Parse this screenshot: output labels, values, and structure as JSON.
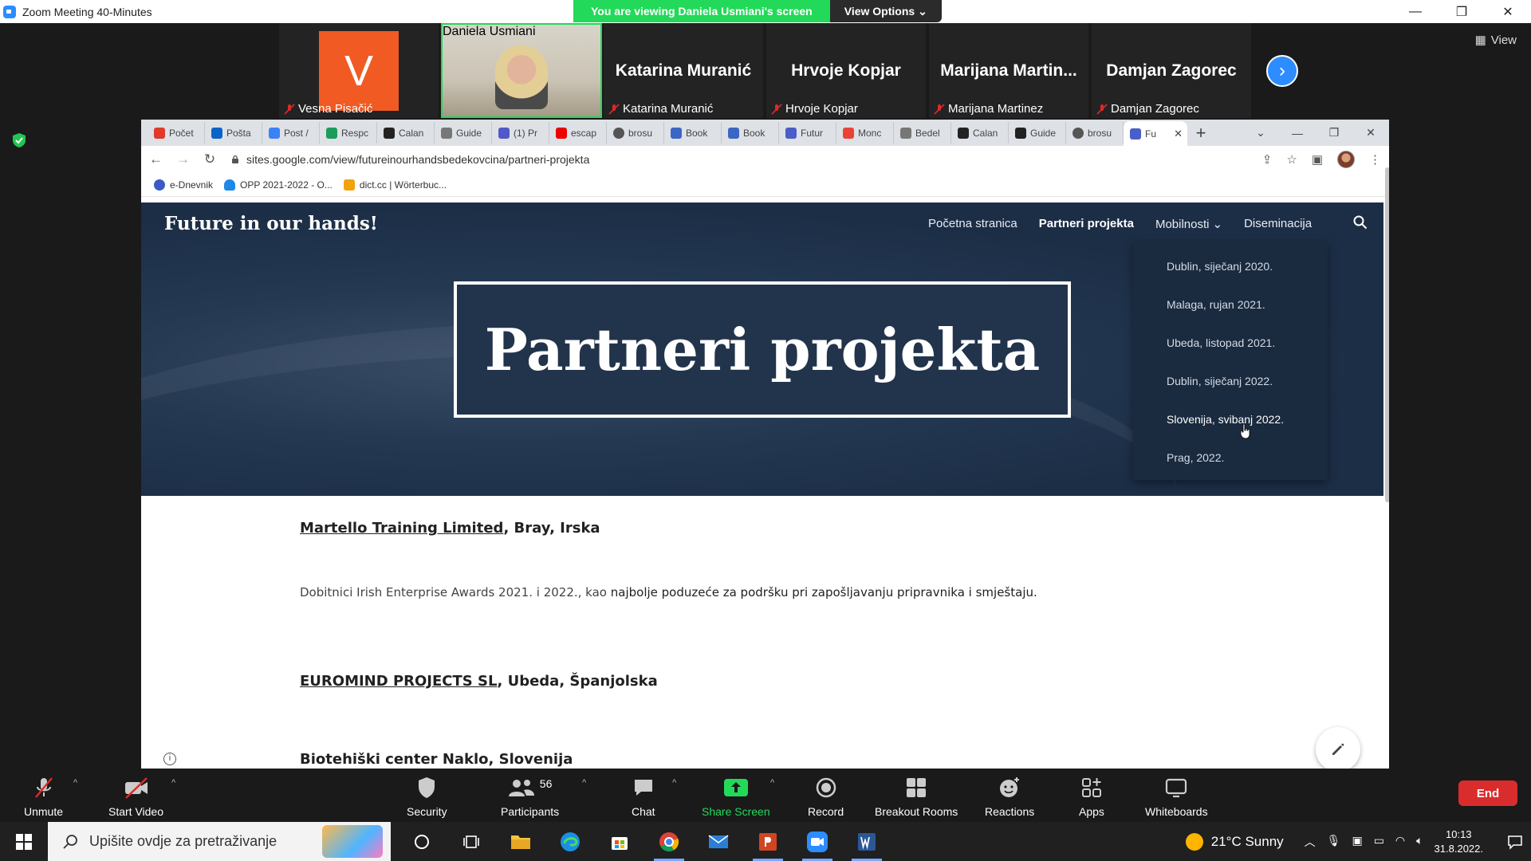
{
  "zoom": {
    "window_title": "Zoom Meeting 40-Minutes",
    "share_banner": "You are viewing Daniela Usmiani's screen",
    "view_options": "View Options",
    "view_label": "View",
    "participants_strip": [
      {
        "name": "Vesna Pisačić",
        "avatar_letter": "V"
      },
      {
        "name": "Daniela Usmiani"
      },
      {
        "name": "Katarina Muranić",
        "display": "Katarina Muranić"
      },
      {
        "name": "Hrvoje Kopjar",
        "display": "Hrvoje Kopjar"
      },
      {
        "name": "Marijana Martinez",
        "display": "Marijana  Martin..."
      },
      {
        "name": "Damjan Zagorec",
        "display": "Damjan Zagorec"
      }
    ],
    "toolbar": {
      "unmute": "Unmute",
      "start_video": "Start Video",
      "security": "Security",
      "participants": "Participants",
      "participants_count": "56",
      "chat": "Chat",
      "share_screen": "Share Screen",
      "record": "Record",
      "breakout_rooms": "Breakout Rooms",
      "reactions": "Reactions",
      "apps": "Apps",
      "whiteboards": "Whiteboards",
      "end": "End"
    }
  },
  "browser": {
    "tabs": [
      "Počet",
      "Pošta",
      "Post /",
      "Respc",
      "Calan",
      "Guide",
      "(1) Pr",
      "escap",
      "brosu",
      "Book",
      "Book",
      "Futur",
      "Monc",
      "Bedel",
      "Calan",
      "Guide",
      "brosu",
      "Fu"
    ],
    "url": "sites.google.com/view/futureinourhandsbedekovcina/partneri-projekta",
    "bookmarks": [
      "e-Dnevnik",
      "OPP 2021-2022 - O...",
      "dict.cc | Wörterbuc..."
    ]
  },
  "site": {
    "title": "Future in our hands!",
    "nav": {
      "home": "Početna stranica",
      "partners": "Partneri projekta",
      "mobility": "Mobilnosti",
      "dissemination": "Diseminacija"
    },
    "hero_heading": "Partneri projekta",
    "dropdown": [
      "Dublin, siječanj 2020.",
      "Malaga, rujan 2021.",
      "Ubeda, listopad 2021.",
      "Dublin, siječanj 2022.",
      "Slovenija, svibanj 2022.",
      "Prag, 2022."
    ],
    "partners": [
      {
        "name": "Martello Training Limited",
        "place": ", Bray, Irska"
      },
      {
        "desc_pre": "Dobitnici Irish Enterprise Awards 2021. i 2022., kao ",
        "desc_bold": "najbolje poduzeće za podršku pri zapošljavanju pripravnika i smještaju."
      },
      {
        "name": "EUROMIND PROJECTS SL",
        "place": ", Ubeda, Španjolska"
      },
      {
        "name_partial": "Biotehiški center Naklo, Slovenija"
      }
    ]
  },
  "taskbar": {
    "search_placeholder": "Upišite ovdje za pretraživanje",
    "weather": "21°C  Sunny",
    "time": "10:13",
    "date": "31.8.2022."
  }
}
